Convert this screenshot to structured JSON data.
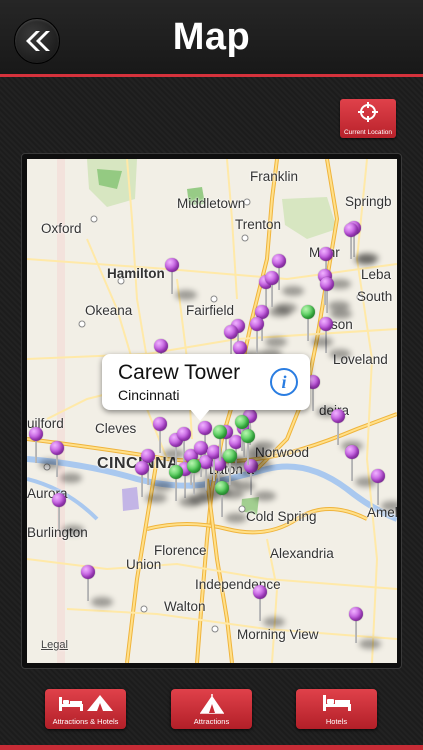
{
  "header": {
    "title": "Map",
    "back_icon": "double-chevron-left-icon"
  },
  "current_location": {
    "label": "Current Location",
    "icon": "crosshair-icon"
  },
  "map": {
    "labels": {
      "franklin": "Franklin",
      "middletown": "Middletown",
      "springboro": "Springb",
      "oxford": "Oxford",
      "trenton": "Trenton",
      "monroe": "Monr",
      "hamilton": "Hamilton",
      "lebanon": "Leba",
      "okeana": "Okeana",
      "fairfield": "Fairfield",
      "south_lebanon": "South",
      "mason": "son",
      "loveland": "Loveland",
      "madeira": "deira",
      "guilford": "uilford",
      "cleves": "Cleves",
      "cincinnati": "CINCINNA",
      "norwood": "Norwood",
      "aurora": "Aurora",
      "latonia": "Laton a",
      "cold_spring": "Cold Spring",
      "amelia": "Ameli",
      "burlington": "Burlington",
      "florence": "Florence",
      "union": "Union",
      "alexandria": "Alexandria",
      "independence": "Independence",
      "walton": "Walton",
      "morning_view": "Morning View",
      "legal": "Legal"
    },
    "callout": {
      "title": "Carew Tower",
      "subtitle": "Cincinnati",
      "icon": "info-icon"
    },
    "colors": {
      "purple_pin": "#b544d6",
      "green_pin": "#3fc44a",
      "road": "#f6c85c",
      "park": "#8dc77b"
    }
  },
  "toolbar": {
    "attractions_hotels": "Attractions & Hotels",
    "attractions": "Attractions",
    "hotels": "Hotels",
    "accent": "#c82c36"
  }
}
